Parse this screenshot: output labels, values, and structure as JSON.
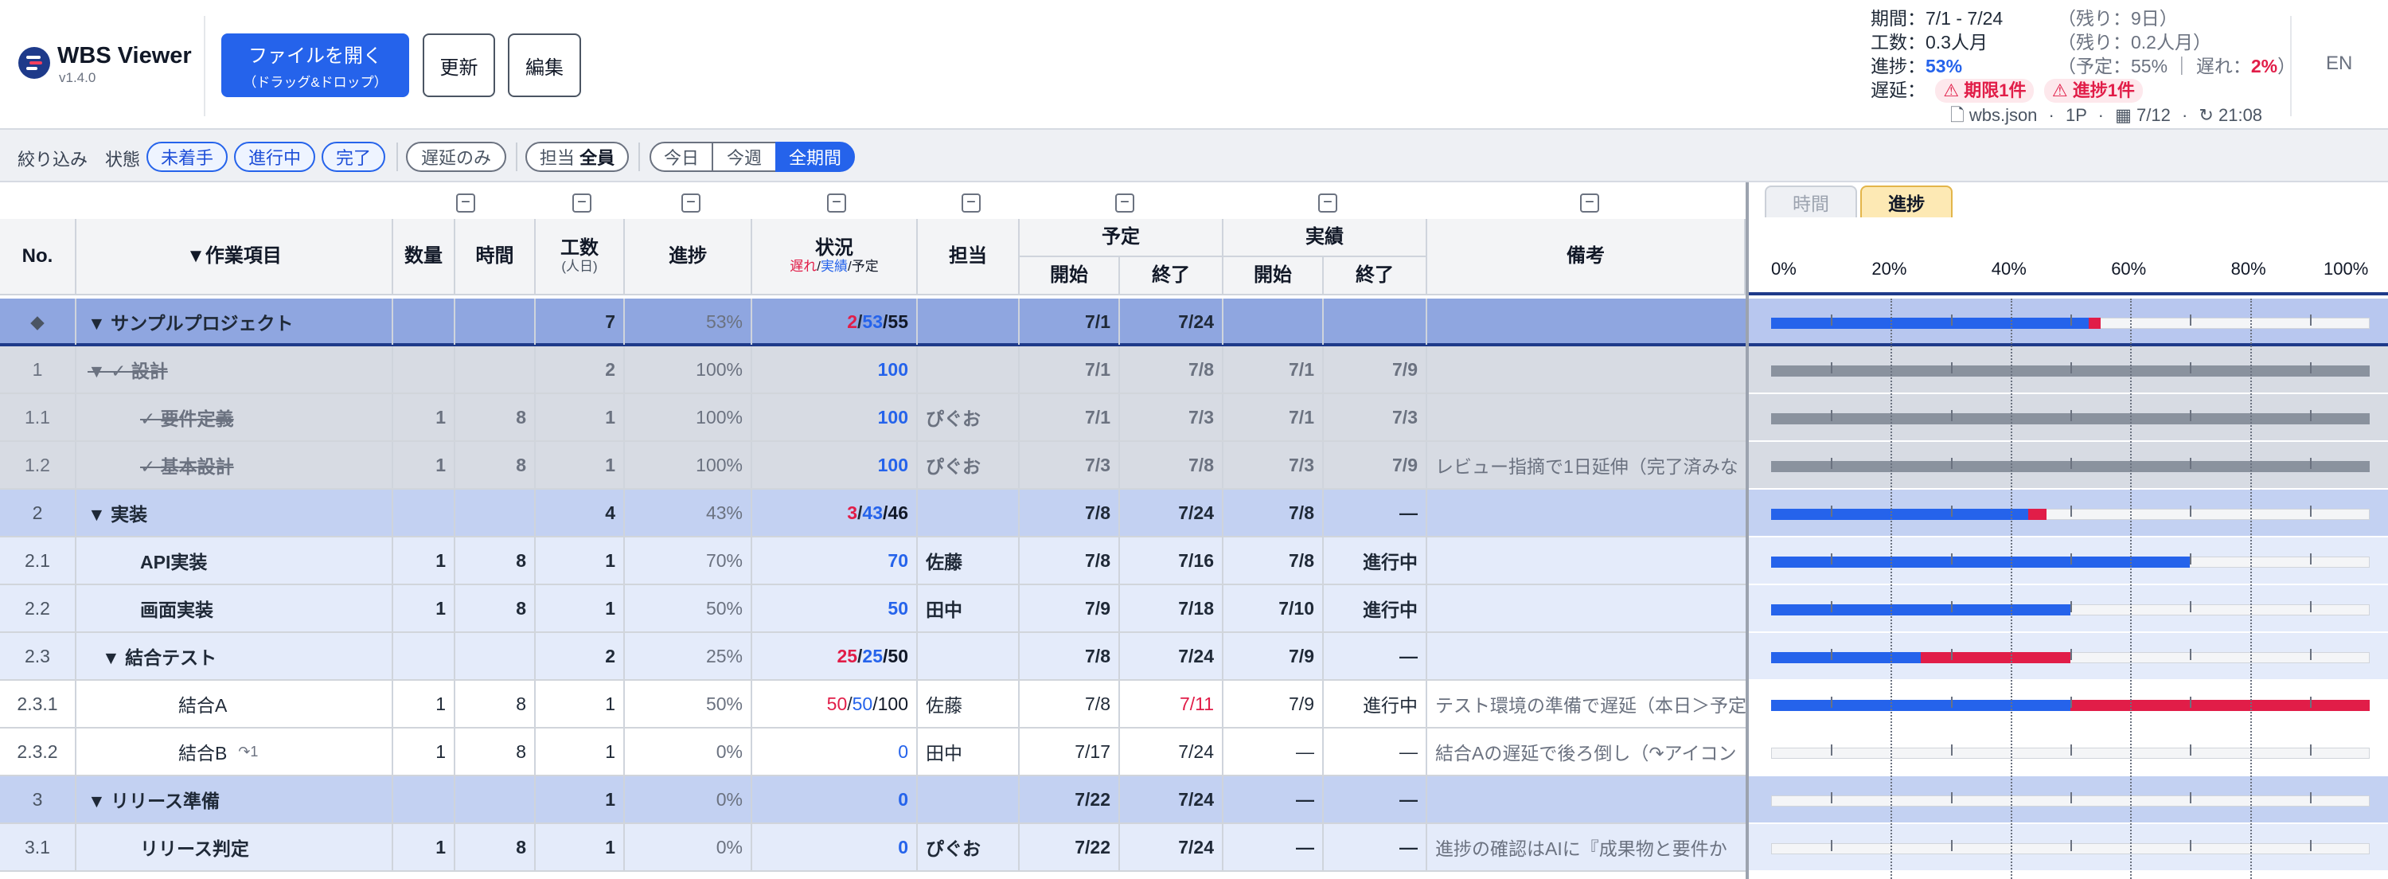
{
  "app": {
    "title": "WBS Viewer",
    "version": "v1.4.0"
  },
  "toolbar": {
    "open_label": "ファイルを開く",
    "open_sub": "（ドラッグ&ドロップ）",
    "refresh_label": "更新",
    "edit_label": "編集"
  },
  "summary": {
    "period_label": "期間：",
    "period_value": "7/1 - 7/24",
    "period_note": "（残り：9日）",
    "effort_label": "工数：",
    "effort_value": "0.3人月",
    "effort_note": "（残り：0.2人月）",
    "progress_label": "進捗：",
    "progress_value": "53%",
    "progress_note_a": "（予定：55% ｜ 遅れ：",
    "progress_note_late": "2%",
    "progress_note_b": "）",
    "delay_label": "遅延：",
    "delay_badge_1": "⚠ 期限1件",
    "delay_badge_2": "⚠ 進捗1件",
    "file_name": "wbs.json",
    "file_pages": "1P",
    "file_date": "7/12",
    "file_time": "21:08"
  },
  "language_toggle": "EN",
  "filter": {
    "label": "絞り込み",
    "status_label": "状態",
    "status_not_started": "未着手",
    "status_in_progress": "進行中",
    "status_done": "完了",
    "delayed_only": "遅延のみ",
    "assignee_prefix": "担当",
    "assignee_value": "全員",
    "range_today": "今日",
    "range_week": "今週",
    "range_all": "全期間"
  },
  "columns": {
    "no": "No.",
    "task": "▼作業項目",
    "qty": "数量",
    "hours": "時間",
    "effort": "工数",
    "effort_unit": "(人日)",
    "progress": "進捗",
    "status": "状況",
    "status_late": "遅れ",
    "status_actual": "実績",
    "status_plan": "予定",
    "assignee": "担当",
    "plan": "予定",
    "actual": "実績",
    "start": "開始",
    "end": "終了",
    "notes": "備考"
  },
  "gantt": {
    "tab_time": "時間",
    "tab_progress": "進捗",
    "ticks": [
      "0%",
      "20%",
      "40%",
      "60%",
      "80%",
      "100%"
    ]
  },
  "rows": [
    {
      "no": "◆",
      "task": "▼ サンプルプロジェクト",
      "qty": "",
      "hours": "",
      "effort": "7",
      "progress": "53%",
      "late": "2",
      "actual": "53",
      "plan": "/55",
      "assignee": "",
      "ps": "7/1",
      "pe": "7/24",
      "as": "",
      "ae": "",
      "note": "",
      "level": 0,
      "style": "row-lvl0",
      "bold": true,
      "done": 53,
      "late_pct": 2
    },
    {
      "no": "1",
      "task": "▼ ✓ 設計",
      "qty": "",
      "hours": "",
      "effort": "2",
      "progress": "100%",
      "late": "",
      "actual": "100",
      "plan": "",
      "assignee": "",
      "ps": "7/1",
      "pe": "7/8",
      "as": "7/1",
      "ae": "7/9",
      "note": "",
      "level": 0,
      "style": "row-done",
      "bold": true,
      "strike": true,
      "done": 100,
      "late_pct": 0,
      "gray": true
    },
    {
      "no": "1.1",
      "task": "✓ 要件定義",
      "qty": "1",
      "hours": "8",
      "effort": "1",
      "progress": "100%",
      "late": "",
      "actual": "100",
      "plan": "",
      "assignee": "ぴぐお",
      "ps": "7/1",
      "pe": "7/3",
      "as": "7/1",
      "ae": "7/3",
      "note": "",
      "level": 2,
      "style": "row-done",
      "bold": true,
      "strike": true,
      "done": 100,
      "late_pct": 0,
      "gray": true
    },
    {
      "no": "1.2",
      "task": "✓ 基本設計",
      "qty": "1",
      "hours": "8",
      "effort": "1",
      "progress": "100%",
      "late": "",
      "actual": "100",
      "plan": "",
      "assignee": "ぴぐお",
      "ps": "7/3",
      "pe": "7/8",
      "as": "7/3",
      "ae": "7/9",
      "note": "レビュー指摘で1日延伸（完了済みな",
      "level": 2,
      "style": "row-done",
      "bold": true,
      "strike": true,
      "done": 100,
      "late_pct": 0,
      "gray": true
    },
    {
      "no": "2",
      "task": "▼ 実装",
      "qty": "",
      "hours": "",
      "effort": "4",
      "progress": "43%",
      "late": "3",
      "actual": "43",
      "plan": "/46",
      "assignee": "",
      "ps": "7/8",
      "pe": "7/24",
      "as": "7/8",
      "ae": "—",
      "note": "",
      "level": 0,
      "style": "row-lvl1",
      "bold": true,
      "done": 43,
      "late_pct": 3
    },
    {
      "no": "2.1",
      "task": "API実装",
      "qty": "1",
      "hours": "8",
      "effort": "1",
      "progress": "70%",
      "late": "",
      "actual": "70",
      "plan": "",
      "assignee": "佐藤",
      "ps": "7/8",
      "pe": "7/16",
      "as": "7/8",
      "ae": "進行中",
      "note": "",
      "level": 2,
      "style": "row-lvl2",
      "bold": true,
      "done": 70,
      "late_pct": 0
    },
    {
      "no": "2.2",
      "task": "画面実装",
      "qty": "1",
      "hours": "8",
      "effort": "1",
      "progress": "50%",
      "late": "",
      "actual": "50",
      "plan": "",
      "assignee": "田中",
      "ps": "7/9",
      "pe": "7/18",
      "as": "7/10",
      "ae": "進行中",
      "note": "",
      "level": 2,
      "style": "row-lvl2",
      "bold": true,
      "done": 50,
      "late_pct": 0
    },
    {
      "no": "2.3",
      "task": "▼ 結合テスト",
      "qty": "",
      "hours": "",
      "effort": "2",
      "progress": "25%",
      "late": "25",
      "actual": "25",
      "plan": "/50",
      "assignee": "",
      "ps": "7/8",
      "pe": "7/24",
      "as": "7/9",
      "ae": "—",
      "note": "",
      "level": 1,
      "style": "row-lvl2",
      "bold": true,
      "done": 25,
      "late_pct": 25
    },
    {
      "no": "2.3.1",
      "task": "結合A",
      "qty": "1",
      "hours": "8",
      "effort": "1",
      "progress": "50%",
      "late": "50",
      "actual": "50",
      "plan": "/100",
      "assignee": "佐藤",
      "ps": "7/8",
      "pe": "7/11",
      "as": "7/9",
      "ae": "進行中",
      "note": "テスト環境の準備で遅延（本日＞予定",
      "level": 3,
      "style": "row-leaf",
      "bold": false,
      "pe_red": true,
      "done": 50,
      "late_pct": 50
    },
    {
      "no": "2.3.2",
      "task": "結合B",
      "task_suffix": "↷1",
      "qty": "1",
      "hours": "8",
      "effort": "1",
      "progress": "0%",
      "late": "",
      "actual": "0",
      "plan": "",
      "assignee": "田中",
      "ps": "7/17",
      "pe": "7/24",
      "as": "—",
      "ae": "—",
      "note": "結合Aの遅延で後ろ倒し（↷アイコン",
      "level": 3,
      "style": "row-leaf",
      "bold": false,
      "done": 0,
      "late_pct": 0
    },
    {
      "no": "3",
      "task": "▼ リリース準備",
      "qty": "",
      "hours": "",
      "effort": "1",
      "progress": "0%",
      "late": "",
      "actual": "0",
      "plan": "",
      "assignee": "",
      "ps": "7/22",
      "pe": "7/24",
      "as": "—",
      "ae": "—",
      "note": "",
      "level": 0,
      "style": "row-lvl1",
      "bold": true,
      "done": 0,
      "late_pct": 0
    },
    {
      "no": "3.1",
      "task": "リリース判定",
      "qty": "1",
      "hours": "8",
      "effort": "1",
      "progress": "0%",
      "late": "",
      "actual": "0",
      "plan": "",
      "assignee": "ぴぐお",
      "ps": "7/22",
      "pe": "7/24",
      "as": "—",
      "ae": "—",
      "note": "進捗の確認はAIに『成果物と要件か",
      "level": 2,
      "style": "row-lvl2",
      "bold": true,
      "done": 0,
      "late_pct": 0
    }
  ],
  "colors": {
    "accent": "#2563eb",
    "late": "#e11d48",
    "done_gray": "#8a929e"
  }
}
